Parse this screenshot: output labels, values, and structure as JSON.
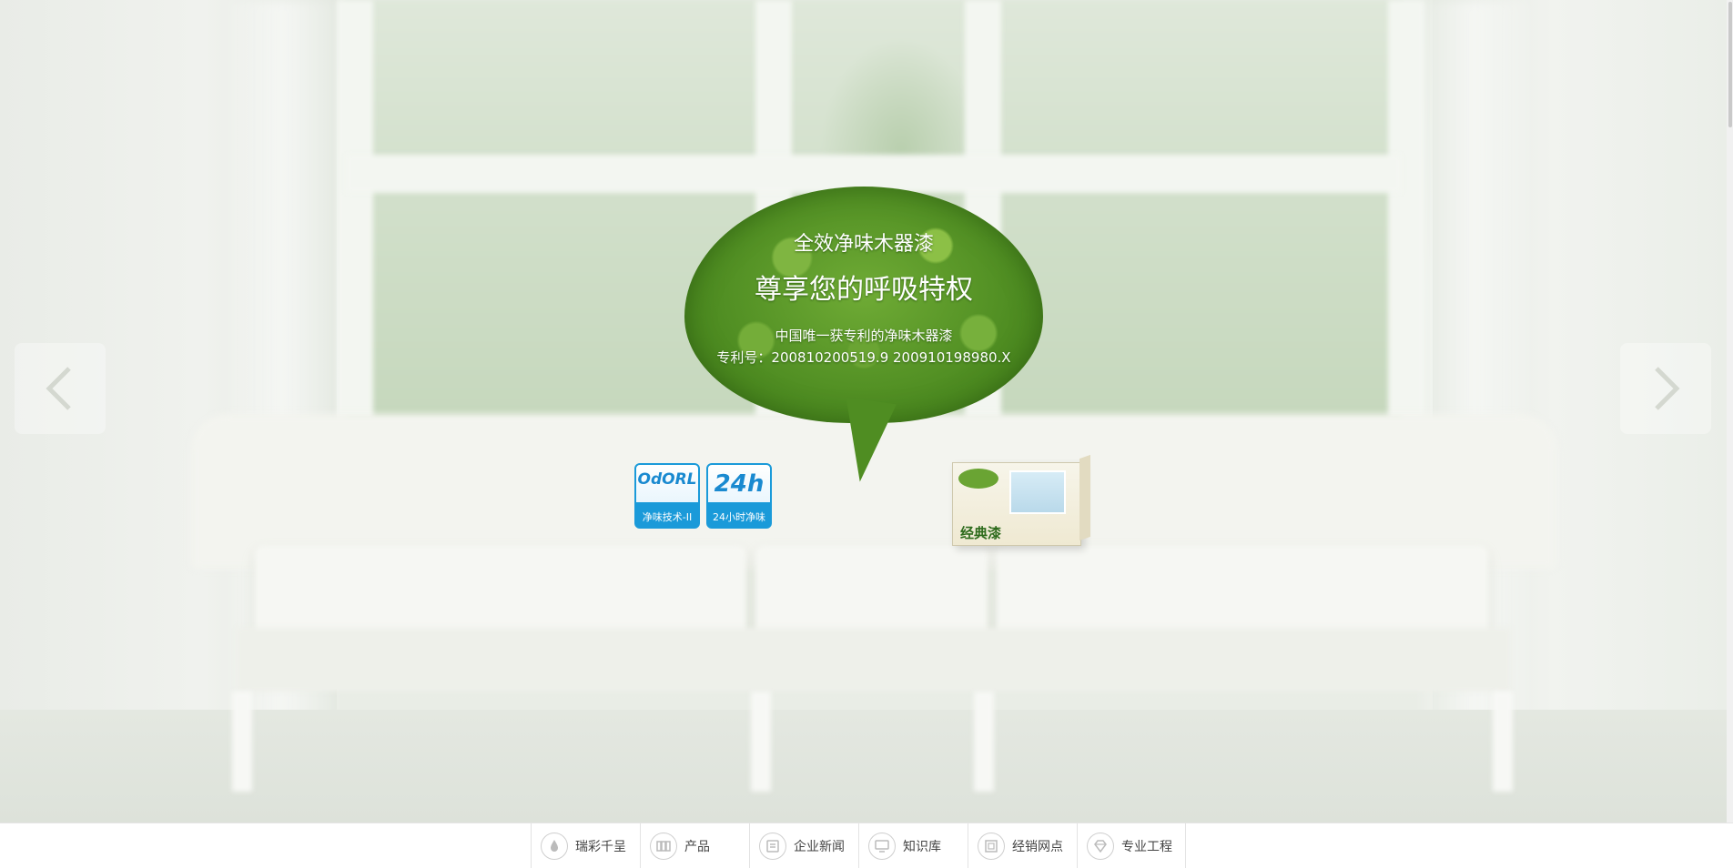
{
  "hero": {
    "headline": "全效净味木器漆",
    "subheadline": "尊享您的呼吸特权",
    "line1": "中国唯一获专利的净味木器漆",
    "line2": "专利号：200810200519.9 200910198980.X"
  },
  "badges": [
    {
      "big": "OdORL",
      "caption": "净味技术-II"
    },
    {
      "big": "24h",
      "caption": "24小时净味"
    }
  ],
  "product": {
    "name": "经典漆"
  },
  "slider": {
    "prev_icon": "chevron-left-icon",
    "next_icon": "chevron-right-icon"
  },
  "nav": {
    "items": [
      {
        "label": "瑞彩千呈",
        "icon": "drop-icon"
      },
      {
        "label": "产品",
        "icon": "product-icon"
      },
      {
        "label": "企业新闻",
        "icon": "news-icon"
      },
      {
        "label": "知识库",
        "icon": "monitor-icon"
      },
      {
        "label": "经销网点",
        "icon": "store-icon"
      },
      {
        "label": "专业工程",
        "icon": "diamond-icon"
      }
    ]
  },
  "colors": {
    "leaf_green": "#5b9a2a",
    "badge_blue": "#1a9ad9",
    "nav_text": "#444444"
  }
}
